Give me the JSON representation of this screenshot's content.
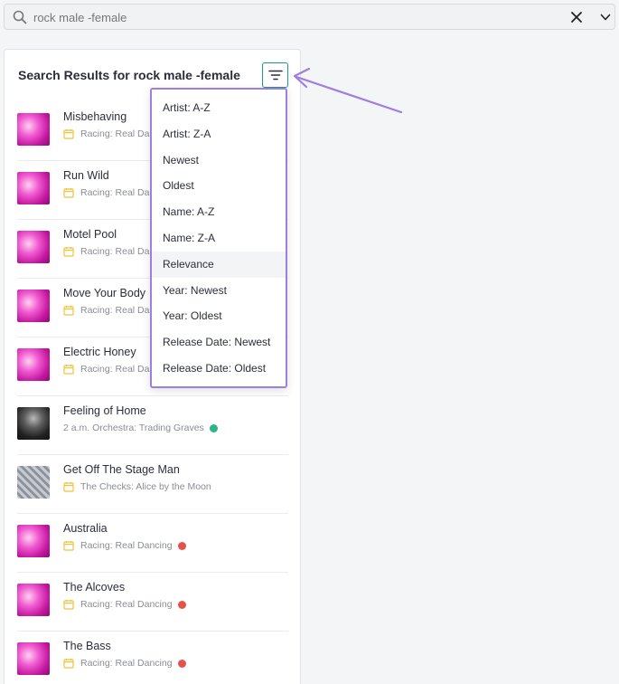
{
  "search": {
    "query": "rock male -female",
    "icon": "search-icon"
  },
  "results": {
    "title": "Search Results for rock male -female",
    "items": [
      {
        "title": "Misbehaving",
        "subtitle": "Racing: Real Da",
        "thumb": "pink",
        "dot": null
      },
      {
        "title": "Run Wild",
        "subtitle": "Racing: Real Da",
        "thumb": "pink",
        "dot": null
      },
      {
        "title": "Motel Pool",
        "subtitle": "Racing: Real Da",
        "thumb": "pink",
        "dot": null
      },
      {
        "title": "Move Your Body",
        "subtitle": "Racing: Real Da",
        "thumb": "pink",
        "dot": null
      },
      {
        "title": "Electric Honey",
        "subtitle": "Racing: Real Da",
        "thumb": "pink",
        "dot": null
      },
      {
        "title": "Feeling of Home",
        "subtitle": "2 a.m. Orchestra: Trading Graves",
        "thumb": "dark",
        "dot": "green"
      },
      {
        "title": "Get Off The Stage Man",
        "subtitle": "The Checks: Alice by the Moon",
        "thumb": "gray",
        "dot": null
      },
      {
        "title": "Australia",
        "subtitle": "Racing: Real Dancing",
        "thumb": "pink",
        "dot": "red"
      },
      {
        "title": "The Alcoves",
        "subtitle": "Racing: Real Dancing",
        "thumb": "pink",
        "dot": "red"
      },
      {
        "title": "The Bass",
        "subtitle": "Racing: Real Dancing",
        "thumb": "pink",
        "dot": "red"
      }
    ]
  },
  "sort_menu": {
    "selected": "Relevance",
    "options": [
      "Artist: A-Z",
      "Artist: Z-A",
      "Newest",
      "Oldest",
      "Name: A-Z",
      "Name: Z-A",
      "Relevance",
      "Year: Newest",
      "Year: Oldest",
      "Release Date: Newest",
      "Release Date: Oldest"
    ]
  },
  "colors": {
    "accent": "#1c9b80",
    "highlight": "#9d7ee2",
    "dot_red": "#e4534a",
    "dot_green": "#2bb58a",
    "calendar": "#f2c23a"
  }
}
